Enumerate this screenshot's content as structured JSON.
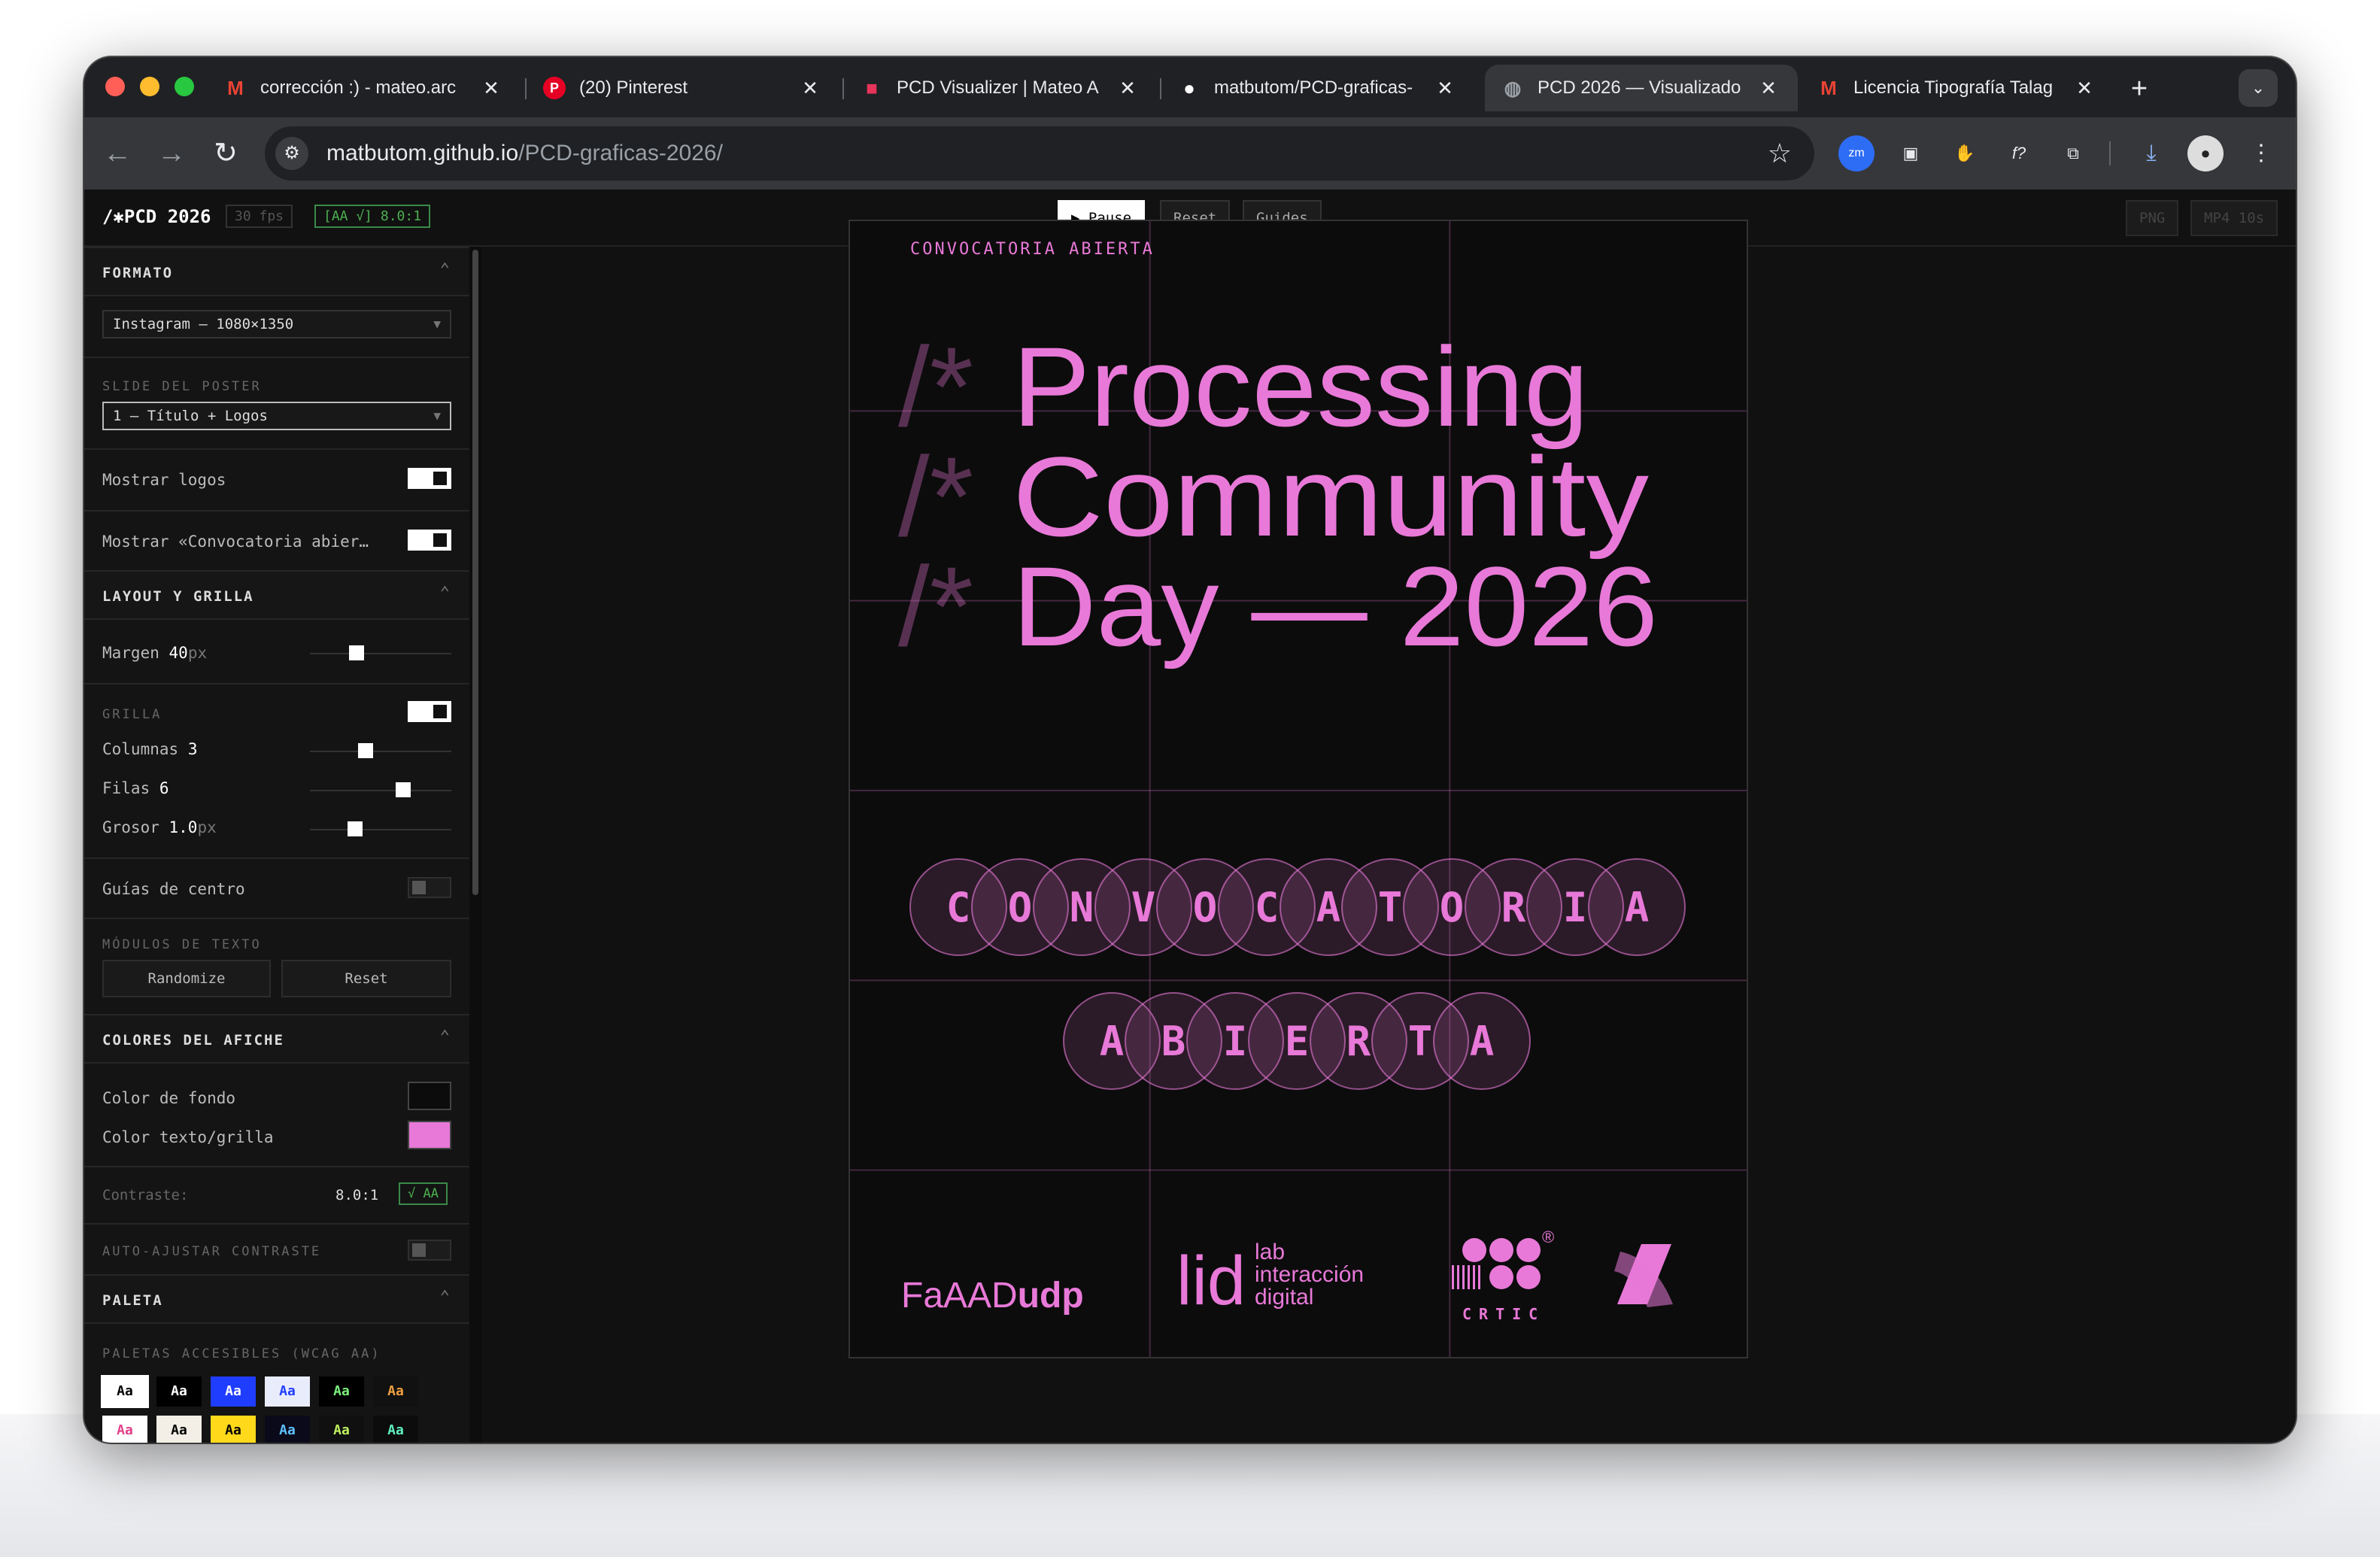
{
  "browser": {
    "tabs": [
      {
        "title": "corrección :) - mateo.arc",
        "fav_color": "#ea4335",
        "fav_glyph": "M"
      },
      {
        "title": "(20) Pinterest",
        "fav_color": "#e60023",
        "fav_glyph": "P"
      },
      {
        "title": "PCD Visualizer | Mateo A",
        "fav_color": "#e8345a",
        "fav_glyph": "■"
      },
      {
        "title": "matbutom/PCD-graficas-",
        "fav_color": "#ffffff",
        "fav_glyph": "●"
      },
      {
        "title": "PCD 2026 — Visualizado",
        "fav_color": "#9aa0a6",
        "fav_glyph": "◍"
      },
      {
        "title": "Licencia Tipografía Talag",
        "fav_color": "#ea4335",
        "fav_glyph": "M"
      }
    ],
    "url_domain": "matbutom.github.io",
    "url_path": "/PCD-graficas-2026/"
  },
  "app": {
    "brand": "/✱PCD 2026",
    "fps": "30 fps",
    "aa_badge": "[AA √] 8.0:1",
    "pause_label": "▶ Pause",
    "reset_label": "Reset",
    "guides_label": "Guides",
    "png_label": "PNG",
    "mp4_label": "MP4 10s"
  },
  "sidebar": {
    "formato_title": "FORMATO",
    "format_select": "Instagram — 1080×1350",
    "slide_label": "SLIDE DEL POSTER",
    "slide_select": "1 — Título + Logos",
    "show_logos": "Mostrar logos",
    "show_convocatoria": "Mostrar «Convocatoria abier…",
    "layout_title": "LAYOUT Y GRILLA",
    "margin_label": "Margen",
    "margin_value": "40",
    "margin_unit": "px",
    "grid_label": "GRILLA",
    "columns_label": "Columnas",
    "columns_value": "3",
    "rows_label": "Filas",
    "rows_value": "6",
    "thickness_label": "Grosor",
    "thickness_value": "1.0",
    "thickness_unit": "px",
    "center_guides": "Guías de centro",
    "text_modules_label": "MÓDULOS DE TEXTO",
    "randomize_label": "Randomize",
    "reset_label": "Reset",
    "colors_title": "COLORES DEL AFICHE",
    "bg_color_label": "Color de fondo",
    "bg_color": "#0c0c0c",
    "text_color_label": "Color texto/grilla",
    "text_color": "#e879d8",
    "contrast_label": "Contraste:",
    "contrast_value": "8.0:1",
    "contrast_badge": "√ AA",
    "auto_contrast": "AUTO-AJUSTAR CONTRASTE",
    "palette_title": "PALETA",
    "palettes_label": "PALETAS ACCESIBLES (WCAG AA)",
    "palettes": [
      {
        "bg": "#ffffff",
        "fg": "#000000"
      },
      {
        "bg": "#000000",
        "fg": "#ffffff"
      },
      {
        "bg": "#1f3dff",
        "fg": "#ffffff"
      },
      {
        "bg": "#e9ecfb",
        "fg": "#1f3dff"
      },
      {
        "bg": "#000000",
        "fg": "#7cf07c"
      },
      {
        "bg": "#111111",
        "fg": "#f0a040"
      },
      {
        "bg": "#ffffff",
        "fg": "#e0408a"
      },
      {
        "bg": "#f4efe6",
        "fg": "#000000"
      },
      {
        "bg": "#ffd91a",
        "fg": "#000000"
      },
      {
        "bg": "#0a0a1a",
        "fg": "#60c0ff"
      },
      {
        "bg": "#101010",
        "fg": "#c0f060"
      },
      {
        "bg": "#0c0c0c",
        "fg": "#60f0c0"
      }
    ],
    "palette_sample": "Aa"
  },
  "poster": {
    "top_label": "CONVOCATORIA ABIERTA",
    "prefix": "/*",
    "lines": [
      "Processing",
      "Community",
      "Day — 2026"
    ],
    "word1": [
      "C",
      "O",
      "N",
      "V",
      "O",
      "C",
      "A",
      "T",
      "O",
      "R",
      "I",
      "A"
    ],
    "word2": [
      "A",
      "B",
      "I",
      "E",
      "R",
      "T",
      "A"
    ],
    "logo_faaad": "FaAAD",
    "logo_udp": "udp",
    "logo_lid": "lid",
    "logo_lid_text": [
      "lab",
      "interacción",
      "digital"
    ],
    "logo_crtic": "CRTIC",
    "logo_crtic_reg": "®"
  }
}
